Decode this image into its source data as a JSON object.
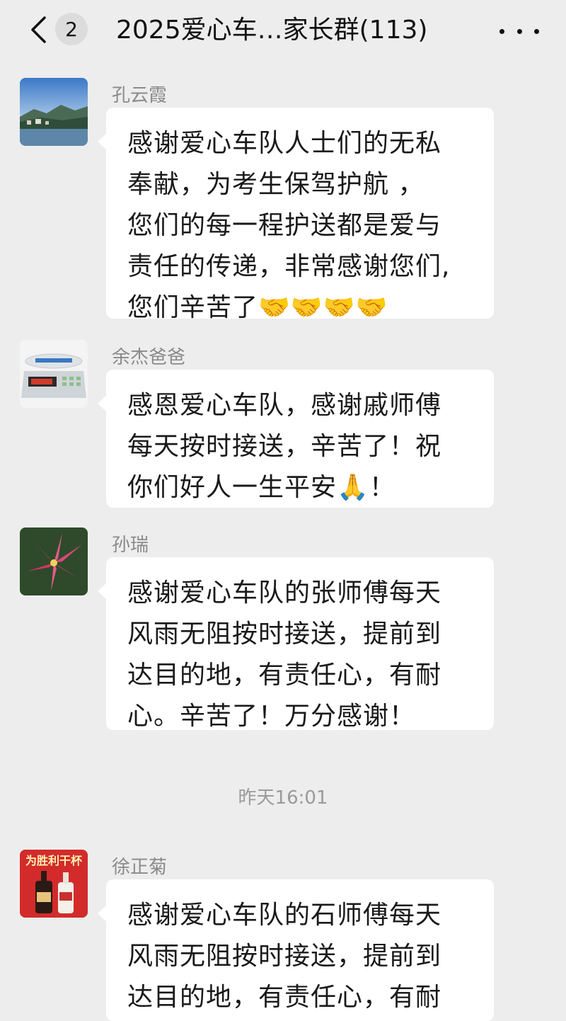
{
  "header": {
    "unread_count": "2",
    "title": "2025爱心车…家长群(113)"
  },
  "messages": [
    {
      "sender": "孔云霞",
      "text": "感谢爱心车队人士们的无私\n奉献，为考生保驾护航 ，\n您们的每一程护送都是爱与\n责任的传递，非常感谢您们,\n您们辛苦了🤝🤝🤝🤝"
    },
    {
      "sender": "余杰爸爸",
      "text": "感恩爱心车队，感谢戚师傅\n每天按时接送，辛苦了！祝\n你们好人一生平安🙏！"
    },
    {
      "sender": "孙瑞",
      "text": "感谢爱心车队的张师傅每天\n风雨无阻按时接送，提前到\n达目的地，有责任心，有耐\n心。辛苦了！万分感谢！"
    },
    {
      "sender": "徐正菊",
      "avatar_text": "为胜利干杯",
      "text": "感谢爱心车队的石师傅每天\n风雨无阻按时接送，提前到\n达目的地，有责任心，有耐"
    }
  ],
  "timestamp": "昨天16:01",
  "icons": {
    "back": "chevron-left-icon",
    "more": "more-dots-icon"
  },
  "colors": {
    "background": "#ededed",
    "bubble": "#ffffff",
    "sender": "#8a8a8a"
  }
}
